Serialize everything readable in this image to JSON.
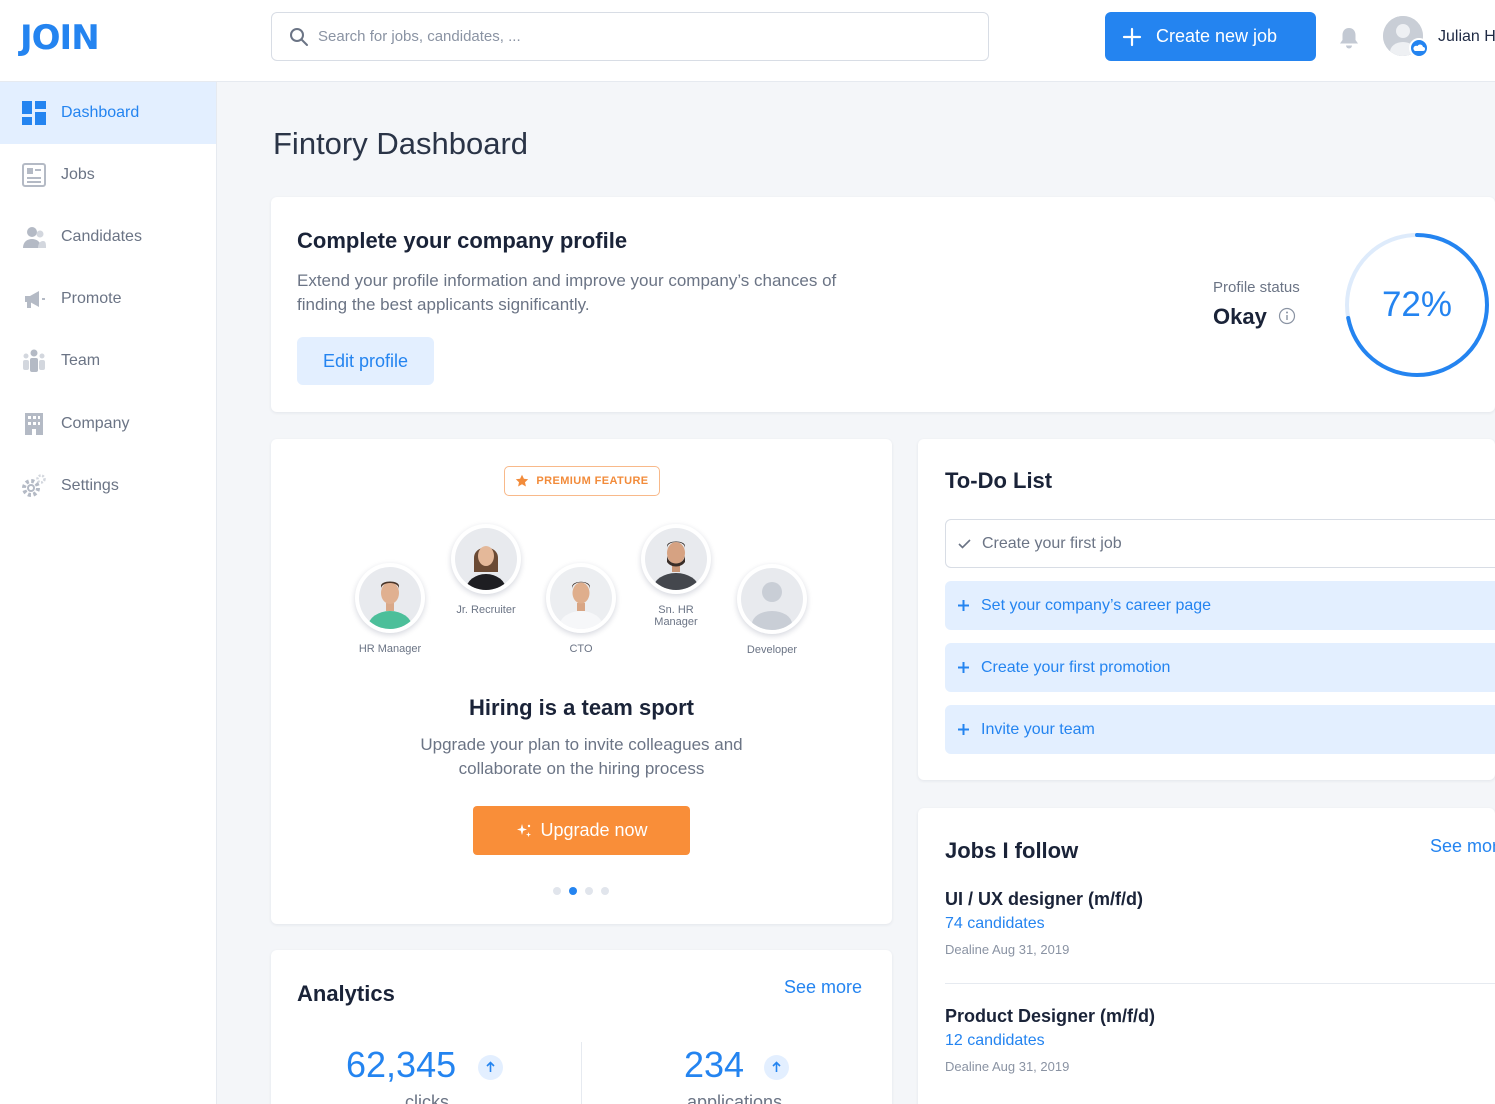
{
  "app": {
    "logo": "JOIN"
  },
  "header": {
    "search_placeholder": "Search for jobs, candidates, ...",
    "create_label": "Create new job",
    "user_name": "Julian H"
  },
  "sidebar": {
    "items": [
      {
        "label": "Dashboard",
        "icon": "dashboard-icon",
        "active": true
      },
      {
        "label": "Jobs",
        "icon": "jobs-icon"
      },
      {
        "label": "Candidates",
        "icon": "candidates-icon"
      },
      {
        "label": "Promote",
        "icon": "megaphone-icon"
      },
      {
        "label": "Team",
        "icon": "team-icon"
      },
      {
        "label": "Company",
        "icon": "building-icon"
      },
      {
        "label": "Settings",
        "icon": "gear-icon"
      }
    ]
  },
  "main": {
    "title": "Fintory Dashboard"
  },
  "profile": {
    "title": "Complete your company profile",
    "description": "Extend your profile information and improve your company’s chances of finding the best applicants significantly.",
    "edit_label": "Edit profile",
    "status_label": "Profile status",
    "status_value": "Okay",
    "percent_text": "72%",
    "percent": 0.72
  },
  "premium": {
    "badge": "PREMIUM FEATURE",
    "team": [
      {
        "role": "HR Manager"
      },
      {
        "role": "Jr. Recruiter"
      },
      {
        "role": "CTO"
      },
      {
        "role": "Sn. HR Manager"
      },
      {
        "role": "Developer"
      }
    ],
    "title": "Hiring is a team sport",
    "subtitle": "Upgrade your plan to invite colleagues and collaborate on the hiring process",
    "upgrade_label": "Upgrade now",
    "carousel_active": 2,
    "carousel_count": 4
  },
  "todo": {
    "title": "To-Do List",
    "items": [
      {
        "label": "Create your first job",
        "done": true
      },
      {
        "label": "Set your company’s career page",
        "done": false
      },
      {
        "label": "Create your first promotion",
        "done": false
      },
      {
        "label": "Invite your team",
        "done": false
      }
    ]
  },
  "analytics": {
    "title": "Analytics",
    "see_more": "See more",
    "stats": [
      {
        "value": "62,345",
        "label": "clicks"
      },
      {
        "value": "234",
        "label": "applications"
      }
    ]
  },
  "jobs_follow": {
    "title": "Jobs I follow",
    "see_more": "See more",
    "jobs": [
      {
        "title": "UI / UX designer (m/f/d)",
        "candidates": "74 candidates",
        "deadline": "Dealine Aug 31, 2019"
      },
      {
        "title": "Product Designer (m/f/d)",
        "candidates": "12 candidates",
        "deadline": "Dealine Aug 31, 2019"
      }
    ]
  },
  "colors": {
    "accent": "#2484f0",
    "accent_light": "#e3efff",
    "orange": "#f98e39"
  }
}
